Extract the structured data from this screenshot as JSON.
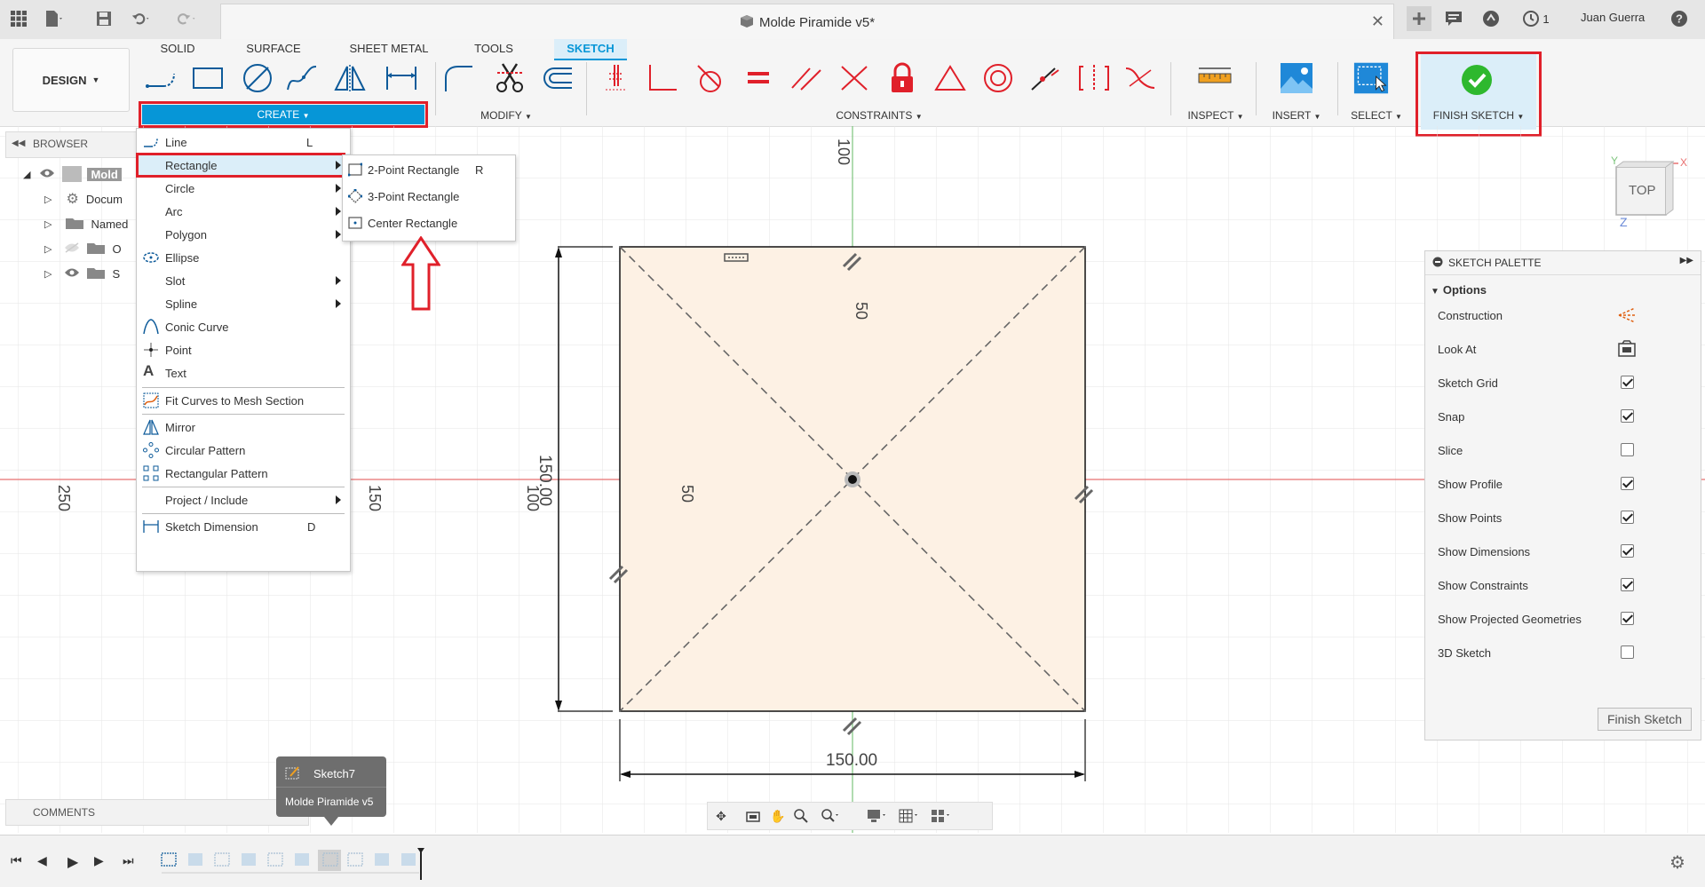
{
  "titlebar": {
    "document_title": "Molde Piramide v5*",
    "user_name": "Juan Guerra",
    "notification_count": "1"
  },
  "ribbon": {
    "workspace_button": "DESIGN",
    "tabs": [
      {
        "label": "SOLID"
      },
      {
        "label": "SURFACE"
      },
      {
        "label": "SHEET METAL"
      },
      {
        "label": "TOOLS"
      },
      {
        "label": "SKETCH"
      }
    ],
    "groups": {
      "create": "CREATE",
      "modify": "MODIFY",
      "constraints": "CONSTRAINTS",
      "inspect": "INSPECT",
      "insert": "INSERT",
      "select": "SELECT",
      "finish_sketch": "FINISH SKETCH"
    }
  },
  "browser": {
    "title": "BROWSER",
    "items": [
      {
        "label": "Mold"
      },
      {
        "label": "Docum"
      },
      {
        "label": "Named"
      },
      {
        "label": "O"
      },
      {
        "label": "S"
      }
    ]
  },
  "create_menu": {
    "items": [
      {
        "label": "Line",
        "shortcut": "L"
      },
      {
        "label": "Rectangle"
      },
      {
        "label": "Circle"
      },
      {
        "label": "Arc"
      },
      {
        "label": "Polygon"
      },
      {
        "label": "Ellipse"
      },
      {
        "label": "Slot"
      },
      {
        "label": "Spline"
      },
      {
        "label": "Conic Curve"
      },
      {
        "label": "Point"
      },
      {
        "label": "Text"
      },
      {
        "label": "Fit Curves to Mesh Section"
      },
      {
        "label": "Mirror"
      },
      {
        "label": "Circular Pattern"
      },
      {
        "label": "Rectangular Pattern"
      },
      {
        "label": "Project / Include"
      },
      {
        "label": "Sketch Dimension",
        "shortcut": "D"
      }
    ]
  },
  "rectangle_submenu": {
    "items": [
      {
        "label": "2-Point Rectangle",
        "shortcut": "R"
      },
      {
        "label": "3-Point Rectangle"
      },
      {
        "label": "Center Rectangle"
      }
    ]
  },
  "viewcube": {
    "face": "TOP",
    "x_axis": "X",
    "y_axis": "Y",
    "z_axis": "Z"
  },
  "canvas": {
    "ruler_labels": {
      "top": "100",
      "left_a": "250",
      "left_b": "150",
      "side_50": "50",
      "side_100": "100",
      "inner_50": "50"
    },
    "dim_vertical": "150.00",
    "dim_horizontal": "150.00"
  },
  "palette": {
    "title": "SKETCH PALETTE",
    "section": "Options",
    "rows": [
      {
        "label": "Construction"
      },
      {
        "label": "Look At"
      },
      {
        "label": "Sketch Grid",
        "checked": true
      },
      {
        "label": "Snap",
        "checked": true
      },
      {
        "label": "Slice",
        "checked": false
      },
      {
        "label": "Show Profile",
        "checked": true
      },
      {
        "label": "Show Points",
        "checked": true
      },
      {
        "label": "Show Dimensions",
        "checked": true
      },
      {
        "label": "Show Constraints",
        "checked": true
      },
      {
        "label": "Show Projected Geometries",
        "checked": true
      },
      {
        "label": "3D Sketch",
        "checked": false
      }
    ],
    "finish_button": "Finish Sketch"
  },
  "comments": {
    "label": "COMMENTS"
  },
  "tooltip": {
    "sketch_name": "Sketch7",
    "doc_name": "Molde Piramide v5"
  },
  "colors": {
    "accent": "#0696d7",
    "highlight": "#e0202a",
    "sketch_fill": "#fdf1e4",
    "axis_green": "#7cc47c",
    "axis_red": "#e87070"
  }
}
